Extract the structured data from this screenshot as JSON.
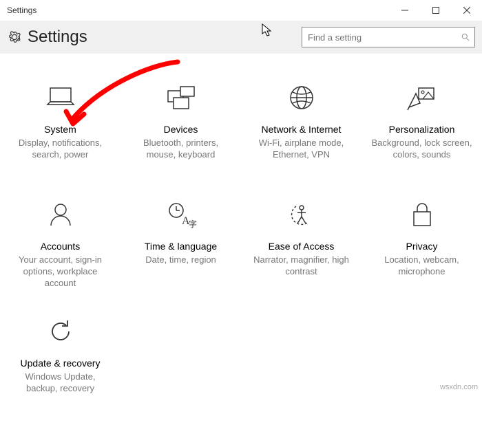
{
  "window": {
    "title": "Settings"
  },
  "header": {
    "title": "Settings"
  },
  "search": {
    "placeholder": "Find a setting"
  },
  "tiles": {
    "system": {
      "title": "System",
      "desc": "Display, notifications, search, power"
    },
    "devices": {
      "title": "Devices",
      "desc": "Bluetooth, printers, mouse, keyboard"
    },
    "network": {
      "title": "Network & Internet",
      "desc": "Wi-Fi, airplane mode, Ethernet, VPN"
    },
    "personal": {
      "title": "Personalization",
      "desc": "Background, lock screen, colors, sounds"
    },
    "accounts": {
      "title": "Accounts",
      "desc": "Your account, sign-in options, workplace account"
    },
    "time": {
      "title": "Time & language",
      "desc": "Date, time, region"
    },
    "ease": {
      "title": "Ease of Access",
      "desc": "Narrator, magnifier, high contrast"
    },
    "privacy": {
      "title": "Privacy",
      "desc": "Location, webcam, microphone"
    },
    "update": {
      "title": "Update & recovery",
      "desc": "Windows Update, backup, recovery"
    }
  },
  "watermark": "wsxdn.com"
}
